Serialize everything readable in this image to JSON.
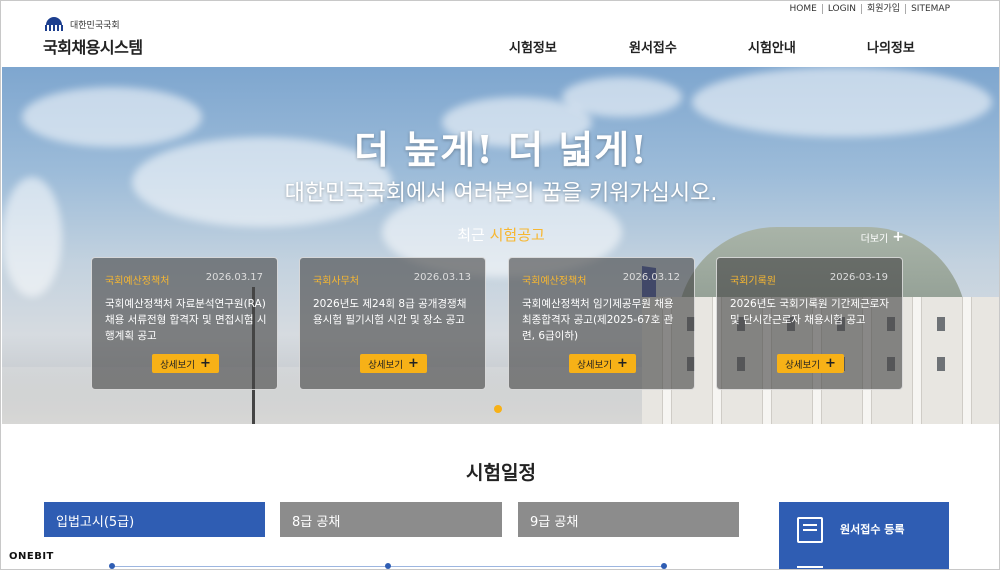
{
  "util_links": [
    "HOME",
    "LOGIN",
    "회원가입",
    "SITEMAP"
  ],
  "logo": {
    "small": "대한민국국회",
    "main": "국회채용시스템"
  },
  "nav": [
    "시험정보",
    "원서접수",
    "시험안내",
    "나의정보"
  ],
  "hero": {
    "title": "더 높게! 더 넓게!",
    "subtitle": "대한민국국회에서 여러분의 꿈을 키워가십시오.",
    "recent_prefix": "최근",
    "recent_highlight": "시험공고",
    "more_label": "더보기",
    "cards": [
      {
        "org": "국회예산정책처",
        "date": "2026.03.17",
        "title": "국회예산정책처 자료분석연구원(RA) 채용 서류전형 합격자 및 면접시험 시행계획 공고",
        "button": "상세보기"
      },
      {
        "org": "국회사무처",
        "date": "2026.03.13",
        "title": "2026년도 제24회 8급 공개경쟁채용시험 필기시험 시간 및 장소 공고",
        "button": "상세보기"
      },
      {
        "org": "국회예산정책처",
        "date": "2026.03.12",
        "title": "국회예산정책처 임기제공무원 채용 최종합격자 공고(제2025-67호 관련, 6급이하)",
        "button": "상세보기"
      },
      {
        "org": "국회기록원",
        "date": "2026-03-19",
        "title": "2026년도 국회기록원 기간제근로자 및 단시간근로자 채용시험 공고",
        "button": "상세보기"
      }
    ]
  },
  "schedule": {
    "title": "시험일정",
    "tabs": [
      "입법고시(5급)",
      "8급 공채",
      "9급 공채"
    ],
    "apply_label": "원서접수 등록"
  },
  "watermark": "ONEBIT",
  "colors": {
    "accent": "#2f5db3",
    "highlight": "#f7b117",
    "tab_inactive": "#8c8c8c"
  }
}
